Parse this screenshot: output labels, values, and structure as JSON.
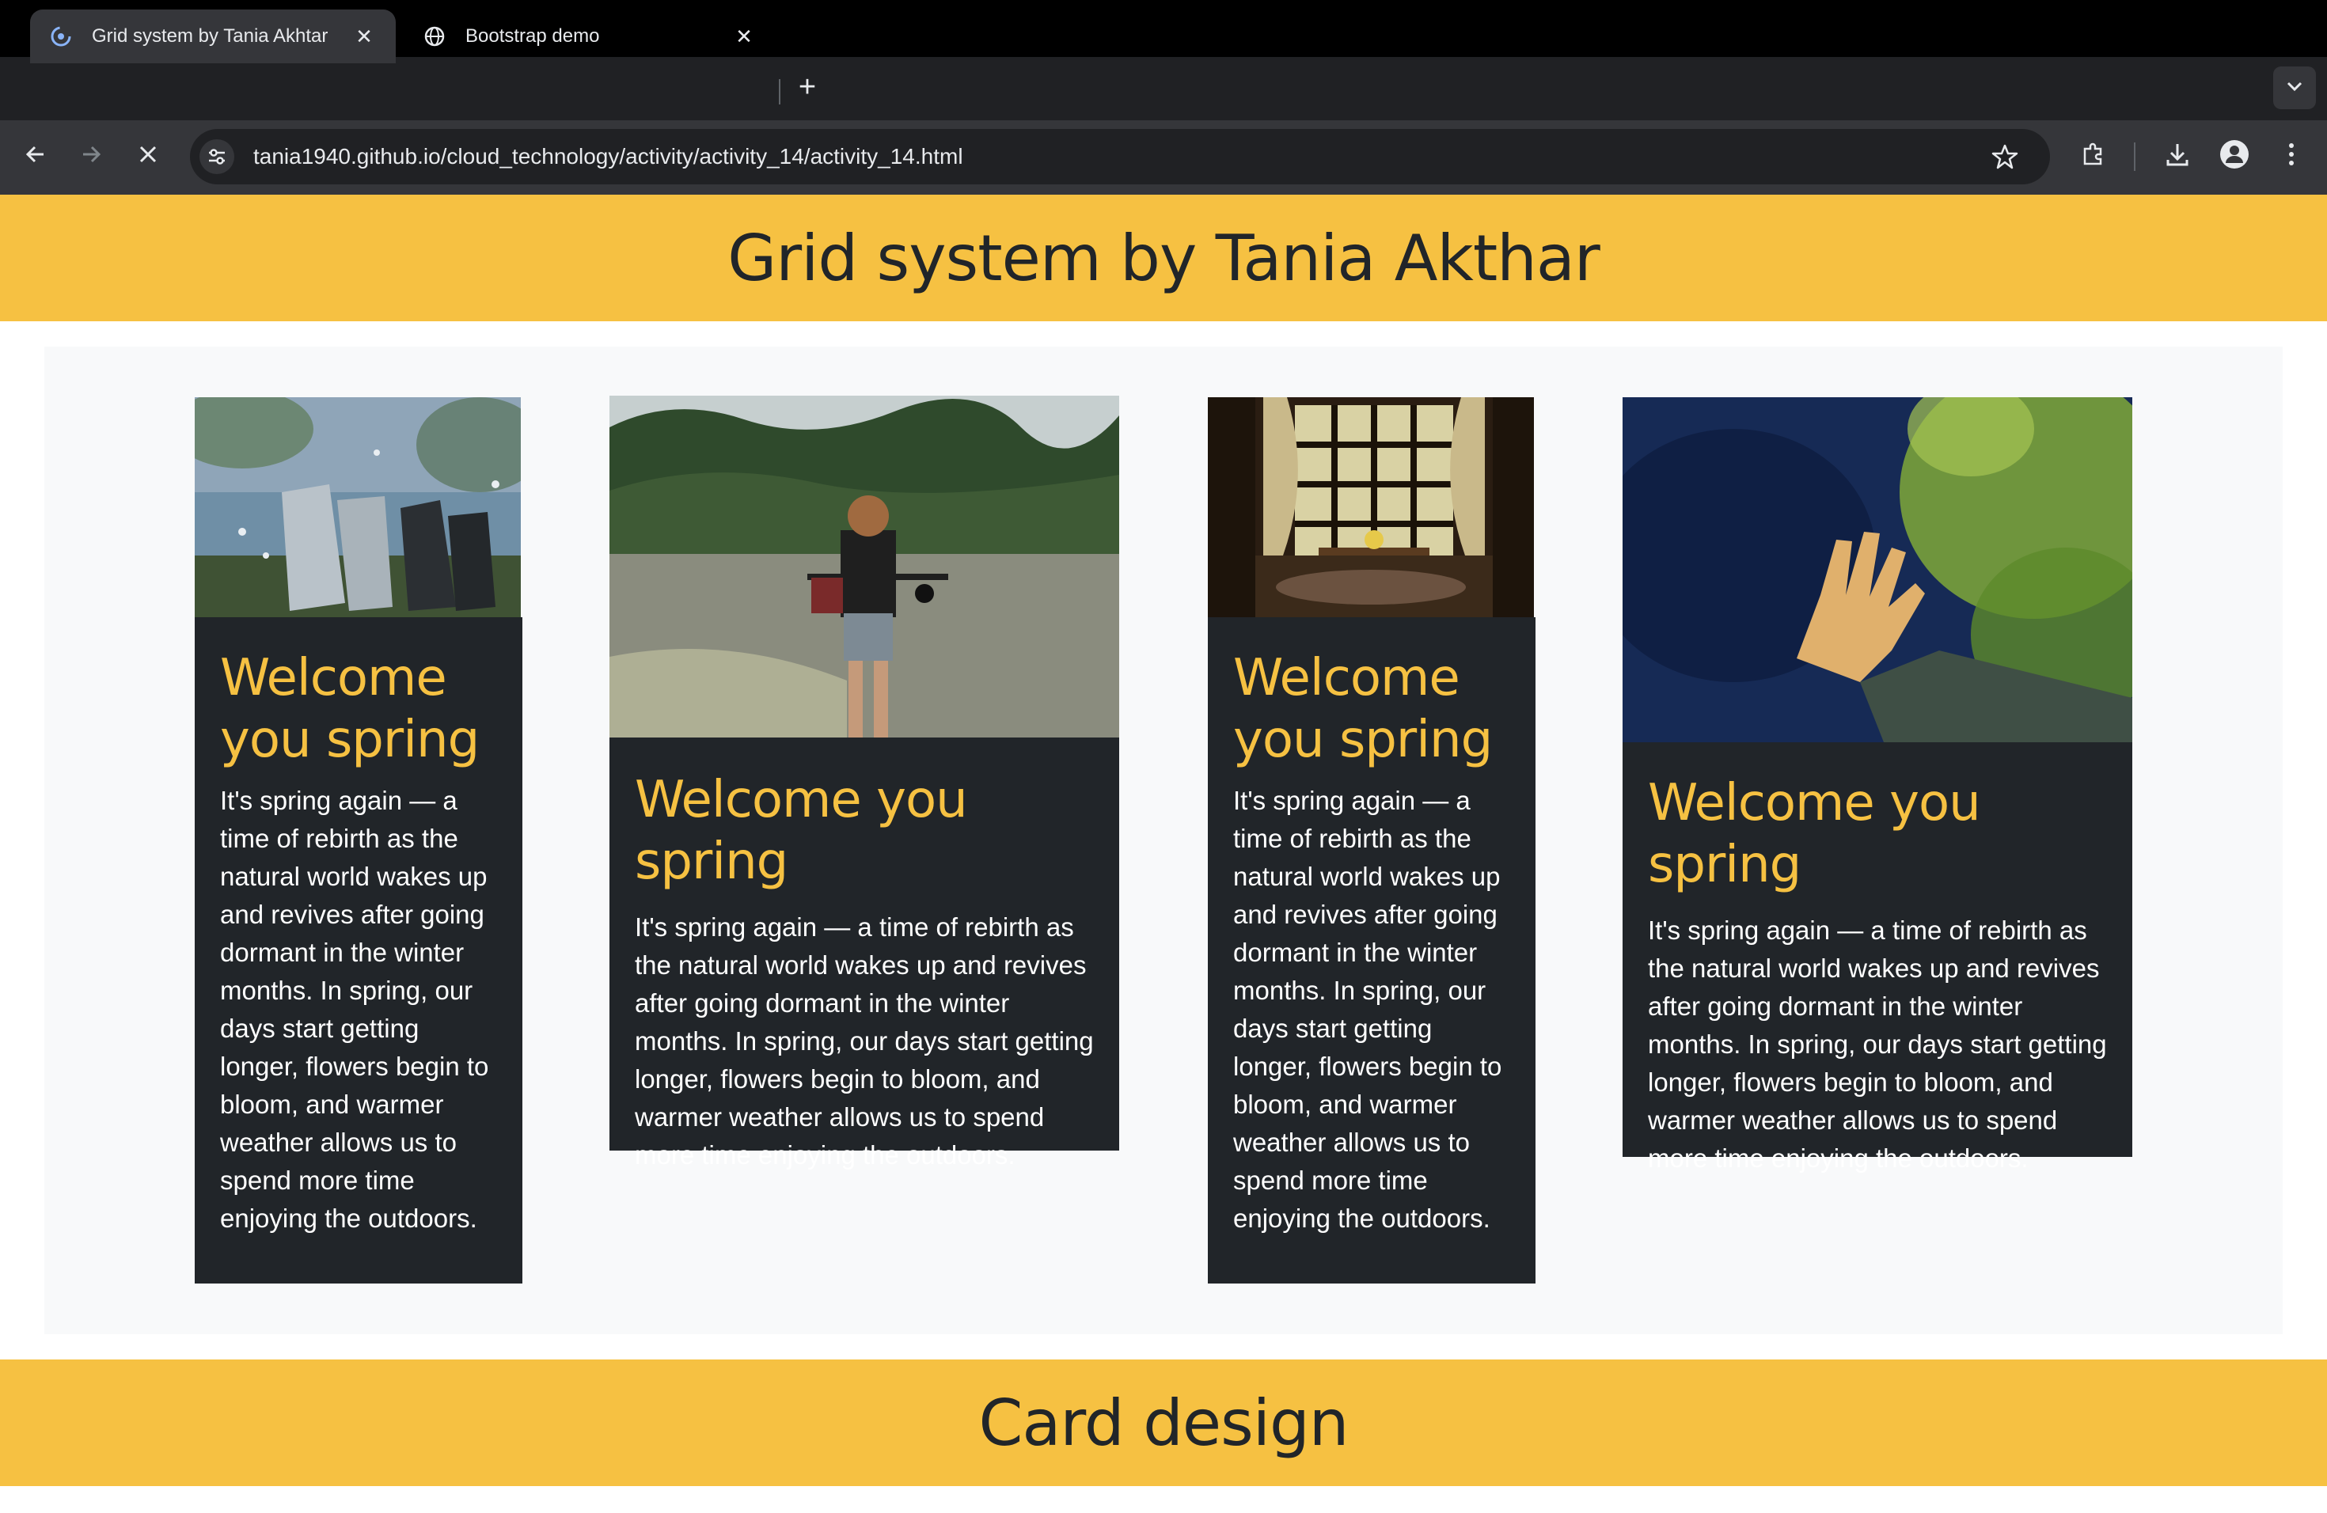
{
  "browser": {
    "tabs": [
      {
        "title": "Grid system by Tania Akhtar",
        "active": true
      },
      {
        "title": "Bootstrap demo",
        "active": false
      }
    ],
    "url": "tania1940.github.io/cloud_technology/activity/activity_14/activity_14.html"
  },
  "page": {
    "heading": "Grid system by Tania Akthar",
    "cards": [
      {
        "title": "Welcome you spring",
        "text": "It's spring again — a time of rebirth as the natural world wakes up and revives after going dormant in the winter months. In spring, our days start getting longer, flowers begin to bloom, and warmer weather allows us to spend more time enjoying the outdoors.",
        "image": "sneakers-over-water"
      },
      {
        "title": "Welcome you spring",
        "text": "It's spring again — a time of rebirth as the natural world wakes up and revives after going dormant in the winter months. In spring, our days start getting longer, flowers begin to bloom, and warmer weather allows us to spend more time enjoying the outdoors.",
        "image": "girl-by-river"
      },
      {
        "title": "Welcome you spring",
        "text": "It's spring again — a time of rebirth as the natural world wakes up and revives after going dormant in the winter months. In spring, our days start getting longer, flowers begin to bloom, and warmer weather allows us to spend more time enjoying the outdoors.",
        "image": "window-with-curtains"
      },
      {
        "title": "Welcome you spring",
        "text": "It's spring again — a time of rebirth as the natural world wakes up and revives after going dormant in the winter months. In spring, our days start getting longer, flowers begin to bloom, and warmer weather allows us to spend more time enjoying the outdoors.",
        "image": "hand-reaching-leaves"
      }
    ],
    "section_heading": "Card design"
  },
  "colors": {
    "accent": "#f6c142",
    "card_bg": "#212529",
    "area_bg": "#f8f9fa"
  }
}
